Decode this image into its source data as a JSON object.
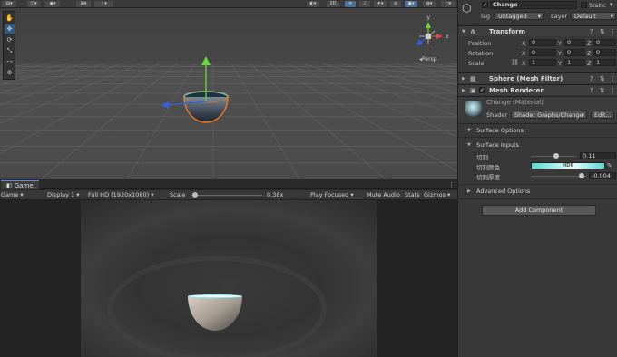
{
  "scene": {
    "toolbar": {
      "mode_2d": "2D"
    },
    "tools": [
      {
        "icon": "hand-tool-icon",
        "glyph": "✋"
      },
      {
        "icon": "move-tool-icon",
        "glyph": "✥"
      },
      {
        "icon": "rotate-tool-icon",
        "glyph": "⟳"
      },
      {
        "icon": "scale-tool-icon",
        "glyph": "⤡"
      },
      {
        "icon": "rect-tool-icon",
        "glyph": "▭"
      },
      {
        "icon": "transform-tool-icon",
        "glyph": "⊕"
      }
    ],
    "gizmo": {
      "y": "y",
      "x": "x",
      "projection": "Persp"
    },
    "colors": {
      "background": "#454545",
      "selection_outline": "#f07a1a",
      "y_axis": "#6ad73a",
      "z_axis": "#3060e8"
    }
  },
  "game": {
    "tab_label": "Game",
    "toolbar": {
      "view": "Game",
      "display": "Display 1",
      "resolution": "Full HD (1920x1080)",
      "scale_label": "Scale",
      "scale_value": "0.38x",
      "scale_slider_fraction": 0.05,
      "play_focused": "Play Focused",
      "mute_audio": "Mute Audio",
      "stats": "Stats",
      "gizmos": "Gizmos"
    }
  },
  "inspector": {
    "object": {
      "name": "Change",
      "active": true,
      "static_label": "Static"
    },
    "tag": {
      "label": "Tag",
      "value": "Untagged"
    },
    "layer": {
      "label": "Layer",
      "value": "Default"
    },
    "transform": {
      "title": "Transform",
      "position": {
        "label": "Position",
        "x": "0",
        "y": "0",
        "z": "0"
      },
      "rotation": {
        "label": "Rotation",
        "x": "0",
        "y": "0",
        "z": "0"
      },
      "scale": {
        "label": "Scale",
        "x": "1",
        "y": "1",
        "z": "1"
      }
    },
    "mesh_filter": {
      "title": "Sphere (Mesh Filter)"
    },
    "mesh_renderer": {
      "title": "Mesh Renderer",
      "enabled": true
    },
    "material": {
      "name": "Change (Material)",
      "shader_label": "Shader",
      "shader_value": "Shader Graphs/Change",
      "edit_label": "Edit..."
    },
    "surface_options": "Surface Options",
    "surface_inputs": {
      "title": "Surface Inputs",
      "cut": {
        "label": "切割",
        "value": "0.11",
        "slider_fraction": 0.55
      },
      "cut_color": {
        "label": "切割颜色",
        "hdr_badge": "HDR"
      },
      "cut_thickness": {
        "label": "切割厚度",
        "value": "-0.004",
        "slider_fraction": 0.9
      }
    },
    "advanced_options": "Advanced Options",
    "add_component": "Add Component"
  }
}
